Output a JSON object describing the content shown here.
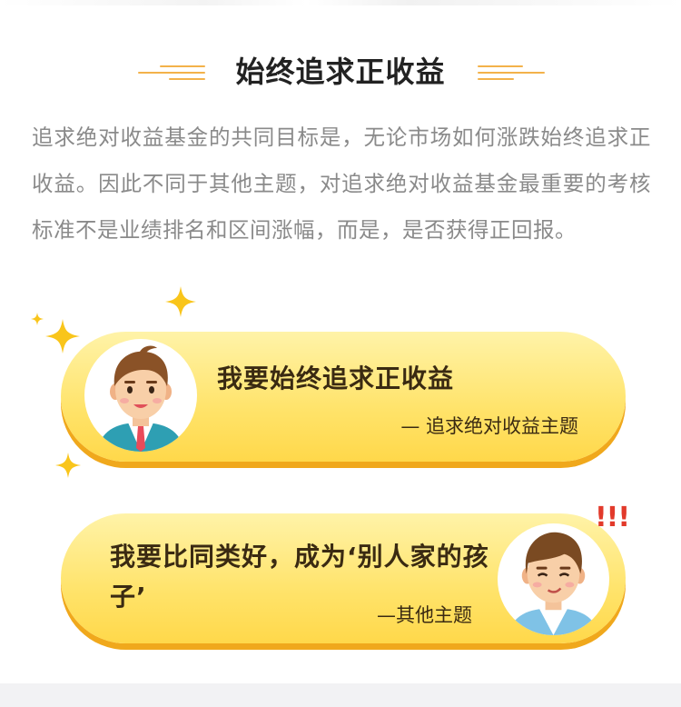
{
  "section": {
    "title": "始终追求正收益",
    "intro": "追求绝对收益基金的共同目标是，无论市场如何涨跌始终追求正收益。因此不同于其他主题，对追求绝对收益基金最重要的考核标准不是业绩排名和区间涨幅，而是，是否获得正回报。"
  },
  "cards": [
    {
      "quote": "我要始终追求正收益",
      "attribution": "— 追求绝对收益主题"
    },
    {
      "quote": "我要比同类好，成为‘别人家的孩子’",
      "attribution": "—其他主题"
    }
  ],
  "alert_text": "!!!",
  "colors": {
    "accent_line": "#f3b24a",
    "card_fill": "#ffe36a",
    "card_shadow": "#f0a81c",
    "alert": "#e23a2b",
    "heading": "#222222",
    "body_text": "#8a8a8a"
  },
  "icons": [
    "sparkle-icon",
    "businessman-avatar-icon",
    "young-man-avatar-icon"
  ]
}
